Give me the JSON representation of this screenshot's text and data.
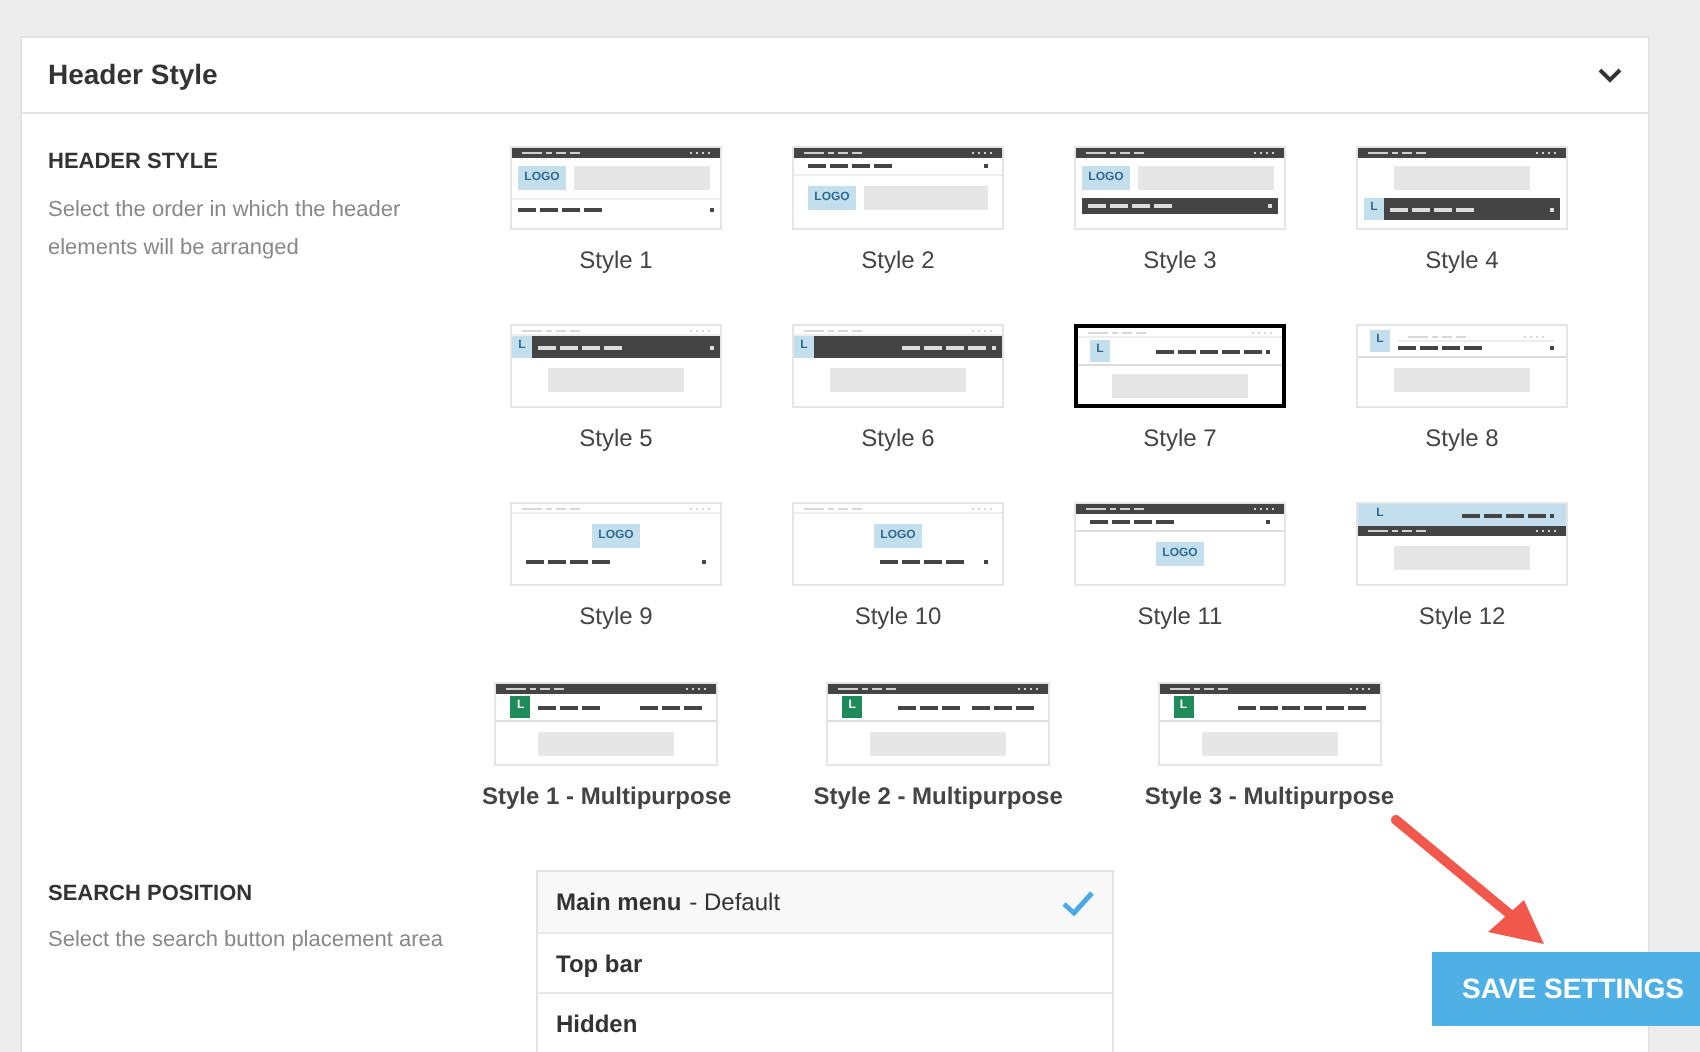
{
  "section": {
    "title": "Header Style",
    "expanded": true
  },
  "header_style": {
    "heading": "HEADER STYLE",
    "description": "Select the order in which the header elements will be arranged",
    "styles": [
      {
        "label": "Style 1",
        "kind": "s1",
        "logo": "LOGO",
        "selected": false
      },
      {
        "label": "Style 2",
        "kind": "s2",
        "logo": "LOGO",
        "selected": false
      },
      {
        "label": "Style 3",
        "kind": "s3",
        "logo": "LOGO",
        "selected": false
      },
      {
        "label": "Style 4",
        "kind": "s4",
        "logo": "L",
        "selected": false
      },
      {
        "label": "Style 5",
        "kind": "s5",
        "logo": "L",
        "selected": false
      },
      {
        "label": "Style 6",
        "kind": "s6",
        "logo": "L",
        "selected": false
      },
      {
        "label": "Style 7",
        "kind": "s7",
        "logo": "L",
        "selected": true
      },
      {
        "label": "Style 8",
        "kind": "s8",
        "logo": "L",
        "selected": false
      },
      {
        "label": "Style 9",
        "kind": "s9",
        "logo": "LOGO",
        "selected": false
      },
      {
        "label": "Style 10",
        "kind": "s10",
        "logo": "LOGO",
        "selected": false
      },
      {
        "label": "Style 11",
        "kind": "s11",
        "logo": "LOGO",
        "selected": false
      },
      {
        "label": "Style 12",
        "kind": "s12",
        "logo": "L",
        "selected": false
      }
    ],
    "multipurpose": [
      {
        "label": "Style 1 - Multipurpose",
        "kind": "m1",
        "logo": "L",
        "selected": false
      },
      {
        "label": "Style 2 - Multipurpose",
        "kind": "m2",
        "logo": "L",
        "selected": false
      },
      {
        "label": "Style 3 - Multipurpose",
        "kind": "m3",
        "logo": "L",
        "selected": false
      }
    ]
  },
  "search_position": {
    "heading": "SEARCH POSITION",
    "description": "Select the search button placement area",
    "options": [
      {
        "label": "Main menu",
        "note": "- Default",
        "selected": true
      },
      {
        "label": "Top bar",
        "selected": false
      },
      {
        "label": "Hidden",
        "selected": false
      }
    ]
  },
  "save_button": "SAVE SETTINGS"
}
